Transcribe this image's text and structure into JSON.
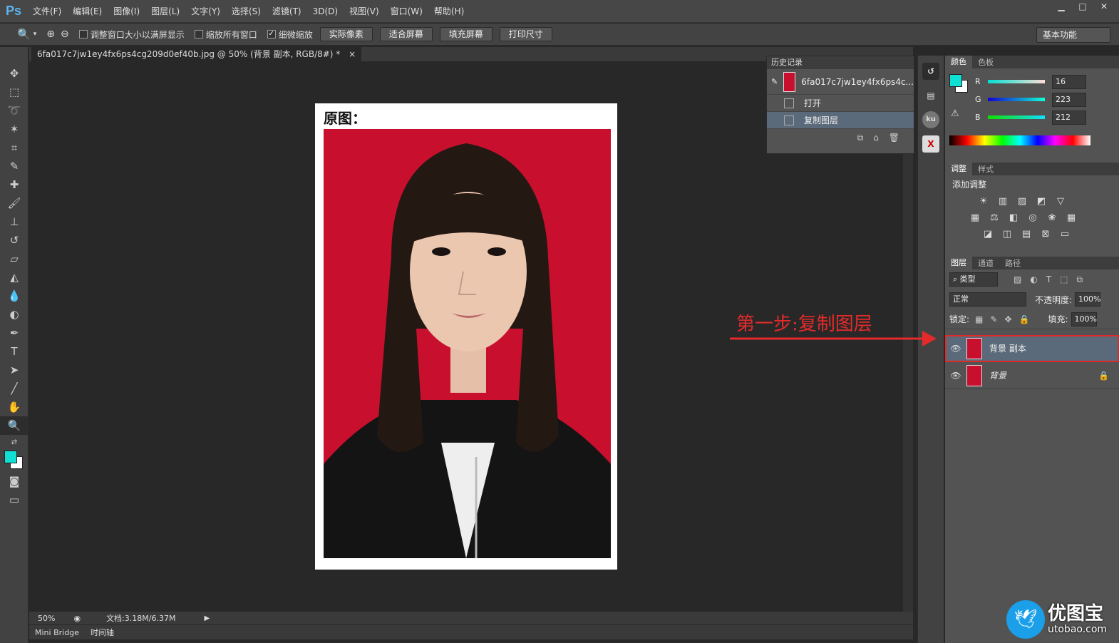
{
  "app": {
    "logo": "Ps"
  },
  "menu": [
    "文件(F)",
    "编辑(E)",
    "图像(I)",
    "图层(L)",
    "文字(Y)",
    "选择(S)",
    "滤镜(T)",
    "3D(D)",
    "视图(V)",
    "窗口(W)",
    "帮助(H)"
  ],
  "options": {
    "check1": "调整窗口大小以满屏显示",
    "check2": "缩放所有窗口",
    "check3": "细微缩放",
    "btn1": "实际像素",
    "btn2": "适合屏幕",
    "btn3": "填充屏幕",
    "btn4": "打印尺寸",
    "workspace": "基本功能"
  },
  "document": {
    "tab_title": "6fa017c7jw1ey4fx6ps4cg209d0ef40b.jpg @ 50% (背景 副本, RGB/8#) *",
    "heading": "原图："
  },
  "status": {
    "zoom": "50%",
    "doc_size": "文档:3.18M/6.37M"
  },
  "bottom_tabs": [
    "Mini Bridge",
    "时间轴"
  ],
  "history": {
    "title": "历史记录",
    "snapshot": "6fa017c7jw1ey4fx6ps4c...",
    "items": [
      "打开",
      "复制图层"
    ]
  },
  "color_panel": {
    "tabs": [
      "颜色",
      "色板"
    ],
    "r_label": "R",
    "g_label": "G",
    "b_label": "B",
    "r": "16",
    "g": "223",
    "b": "212",
    "fg_color": "#10dfd4"
  },
  "adjust_panel": {
    "tabs": [
      "调整",
      "样式"
    ],
    "title": "添加调整"
  },
  "layers_panel": {
    "tabs": [
      "图层",
      "通道",
      "路径"
    ],
    "filter": "类型",
    "blend": "正常",
    "opacity_label": "不透明度:",
    "opacity": "100%",
    "lock_label": "锁定:",
    "fill_label": "填充:",
    "fill": "100%",
    "layers": [
      "背景 副本",
      "背景"
    ]
  },
  "annotation": "第一步:复制图层",
  "watermark": {
    "name": "优图宝",
    "url": "utobao.com"
  },
  "colors": {
    "annotation": "#e42a2a",
    "photo_bg": "#c8102e",
    "selection": "#5b6a7a"
  }
}
